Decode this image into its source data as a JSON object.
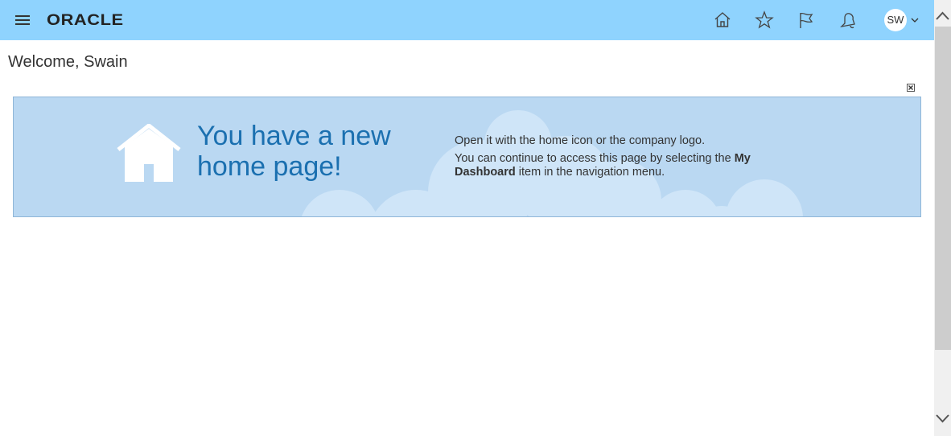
{
  "header": {
    "logo_text": "ORACLE",
    "user_initials": "SW",
    "icons": [
      "menu-icon",
      "home-icon",
      "star-icon",
      "flag-icon",
      "bell-icon",
      "chevron-down-icon"
    ],
    "background": "#8fd3fe"
  },
  "welcome": {
    "text": "Welcome, Swain"
  },
  "banner": {
    "headline": "You have a new home page!",
    "line1": "Open it with the home icon or the company logo.",
    "line2_prefix": "You can continue to access this page by selecting the ",
    "line2_bold": "My Dashboard",
    "line2_suffix": " item in the navigation menu.",
    "background": "#bad8f2",
    "headline_color": "#1b70b0"
  }
}
